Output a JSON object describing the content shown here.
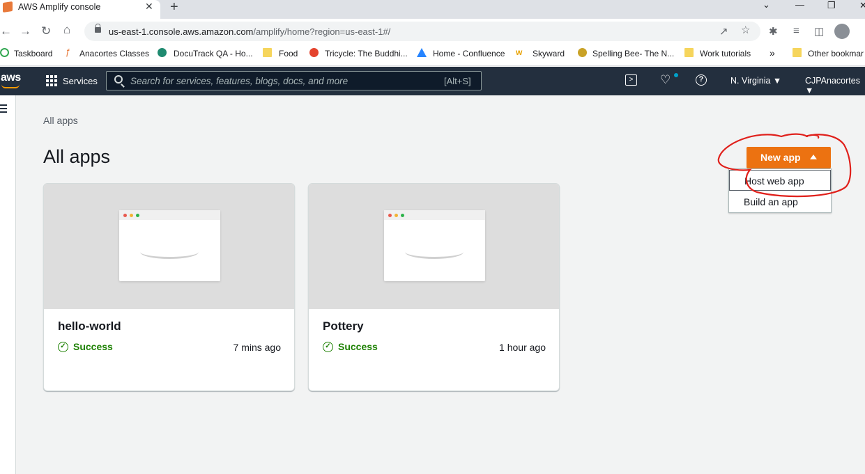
{
  "browser": {
    "tab_title": "AWS Amplify console",
    "tab_close": "✕",
    "new_tab": "+",
    "url_host": "us-east-1.console.aws.amazon.com",
    "url_path": "/amplify/home?region=us-east-1#/",
    "bookmarks": [
      {
        "label": "Taskboard"
      },
      {
        "label": "Anacortes Classes"
      },
      {
        "label": "DocuTrack QA - Ho..."
      },
      {
        "label": "Food"
      },
      {
        "label": "Tricycle: The Buddhi..."
      },
      {
        "label": "Home - Confluence"
      },
      {
        "label": "Skyward"
      },
      {
        "label": "Spelling Bee- The N..."
      },
      {
        "label": "Work tutorials"
      },
      {
        "label": "»"
      },
      {
        "label": "Other bookmar"
      }
    ]
  },
  "aws_header": {
    "logo": "aws",
    "services_label": "Services",
    "search_placeholder": "Search for services, features, blogs, docs, and more",
    "search_shortcut": "[Alt+S]",
    "region": "N. Virginia ▼",
    "account": "CJPAnacortes ▼"
  },
  "main": {
    "breadcrumb": "All apps",
    "title": "All apps",
    "new_app_label": "New app",
    "new_app_menu": [
      "Host web app",
      "Build an app"
    ],
    "apps": [
      {
        "name": "hello-world",
        "status": "Success",
        "updated": "7 mins ago"
      },
      {
        "name": "Pottery",
        "status": "Success",
        "updated": "1 hour ago"
      }
    ]
  },
  "colors": {
    "aws_nav": "#232f3e",
    "primary_button": "#ec7211",
    "success": "#1d8102",
    "annotation": "#e0201b"
  }
}
